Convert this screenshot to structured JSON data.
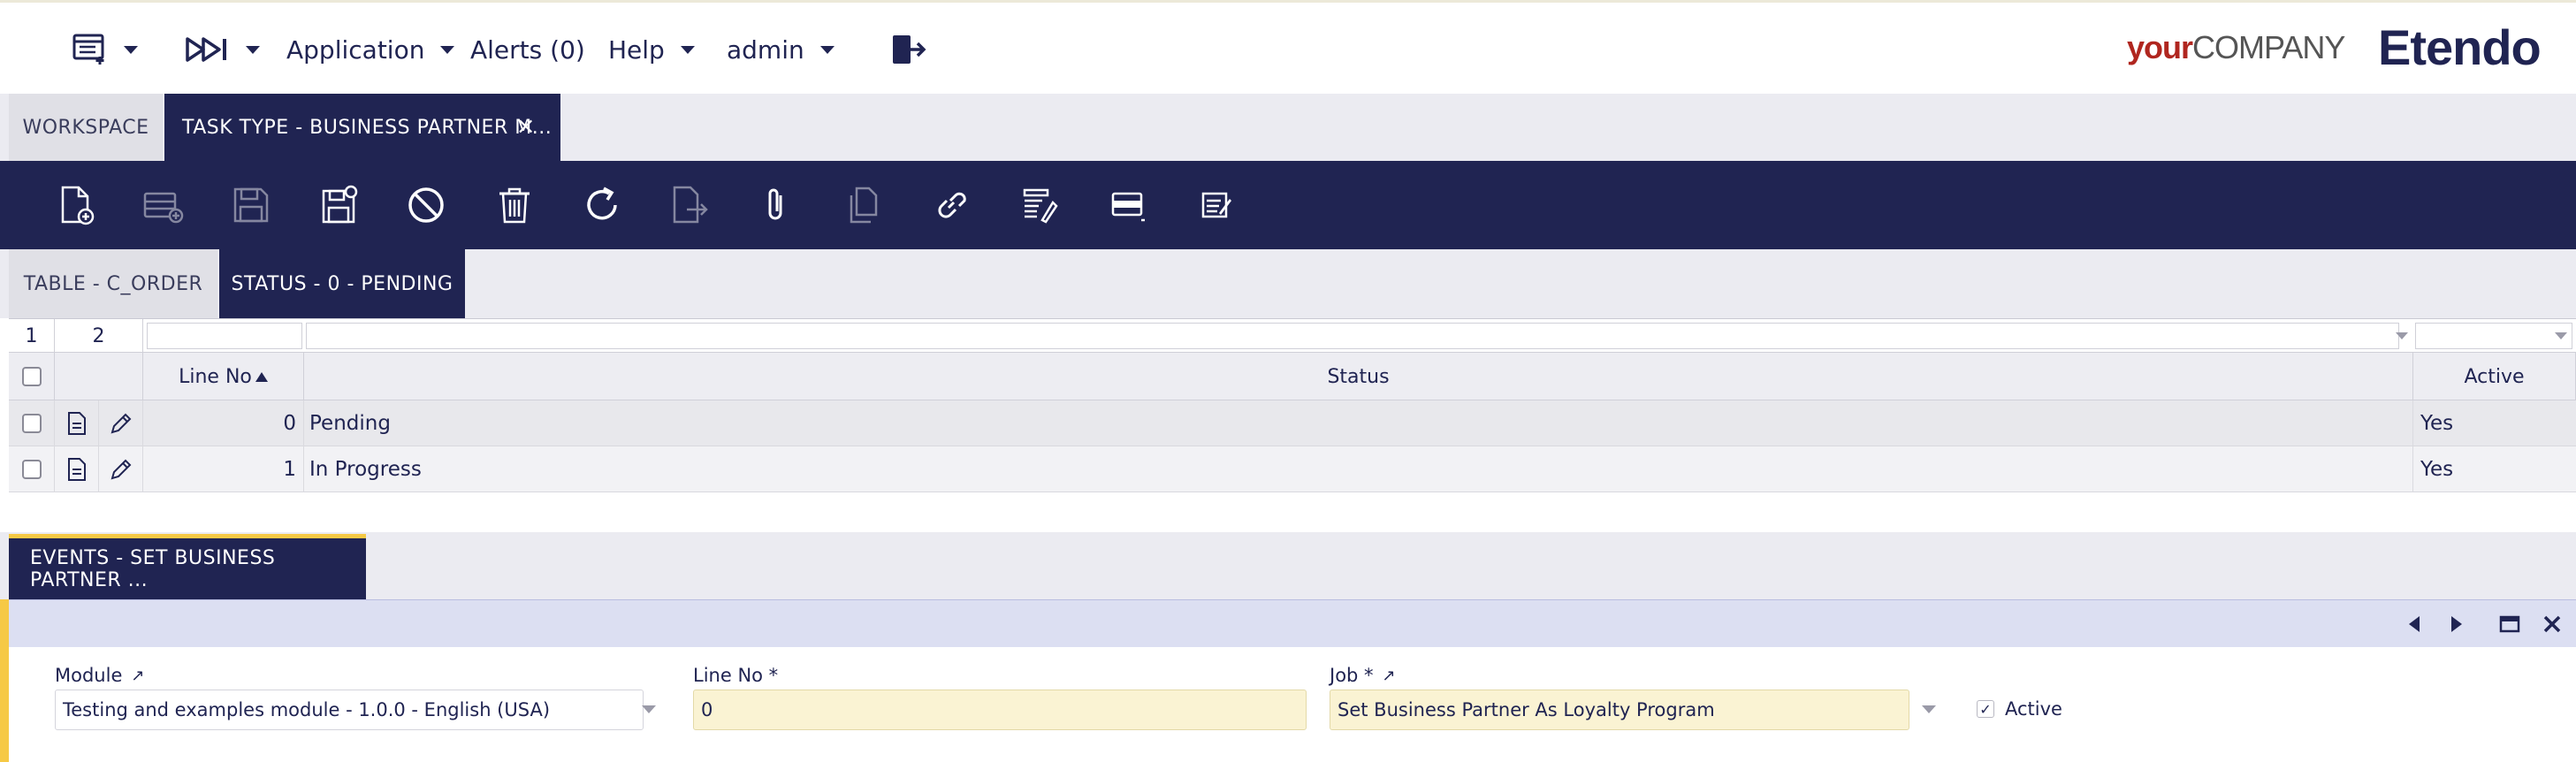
{
  "nav": {
    "application": "Application",
    "alerts": "Alerts (0)",
    "help": "Help",
    "user": "admin"
  },
  "brand": {
    "company_your": "your",
    "company_name": "COMPANY",
    "product": "Etendo"
  },
  "window_tabs": {
    "workspace": "WORKSPACE",
    "active": "TASK TYPE - BUSINESS PARTNER M...",
    "close": "×"
  },
  "toolbar": {
    "icons": [
      "new-document-icon",
      "new-row-icon",
      "save-icon",
      "save-close-icon",
      "cancel-icon",
      "delete-icon",
      "refresh-icon",
      "export-icon",
      "attach-icon",
      "clone-icon",
      "link-icon",
      "print-icon",
      "grid-view-icon",
      "notes-icon"
    ]
  },
  "sub_tabs": {
    "table": "TABLE - C_ORDER",
    "status": "STATUS - 0 - PENDING"
  },
  "grid": {
    "page_1": "1",
    "page_2": "2",
    "columns": {
      "line_no": "Line No",
      "status": "Status",
      "active": "Active"
    },
    "rows": [
      {
        "line_no": "0",
        "status": "Pending",
        "active": "Yes"
      },
      {
        "line_no": "1",
        "status": "In Progress",
        "active": "Yes"
      }
    ]
  },
  "events_tab": {
    "label": "EVENTS - SET BUSINESS PARTNER ..."
  },
  "form": {
    "module_label": "Module",
    "module_value": "Testing and examples module - 1.0.0 - English (USA)",
    "line_no_label": "Line No *",
    "line_no_value": "0",
    "job_label": "Job *",
    "job_value": "Set Business Partner As Loyalty Program",
    "active_label": "Active",
    "active_check": "✓"
  },
  "colors": {
    "primary": "#202452",
    "accent": "#f6c945",
    "required_field": "#faf3d3"
  }
}
